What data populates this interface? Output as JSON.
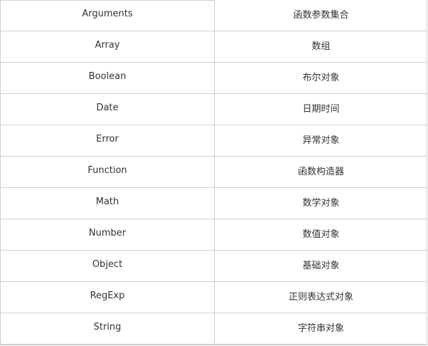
{
  "rows": [
    {
      "name": "Arguments",
      "description": "函数参数集合"
    },
    {
      "name": "Array",
      "description": "数组"
    },
    {
      "name": "Boolean",
      "description": "布尔对象"
    },
    {
      "name": "Date",
      "description": "日期时间"
    },
    {
      "name": "Error",
      "description": "异常对象"
    },
    {
      "name": "Function",
      "description": "函数构造器"
    },
    {
      "name": "Math",
      "description": "数学对象"
    },
    {
      "name": "Number",
      "description": "数值对象"
    },
    {
      "name": "Object",
      "description": "基础对象"
    },
    {
      "name": "RegExp",
      "description": "正则表达式对象"
    },
    {
      "name": "String",
      "description": "字符串对象"
    }
  ]
}
